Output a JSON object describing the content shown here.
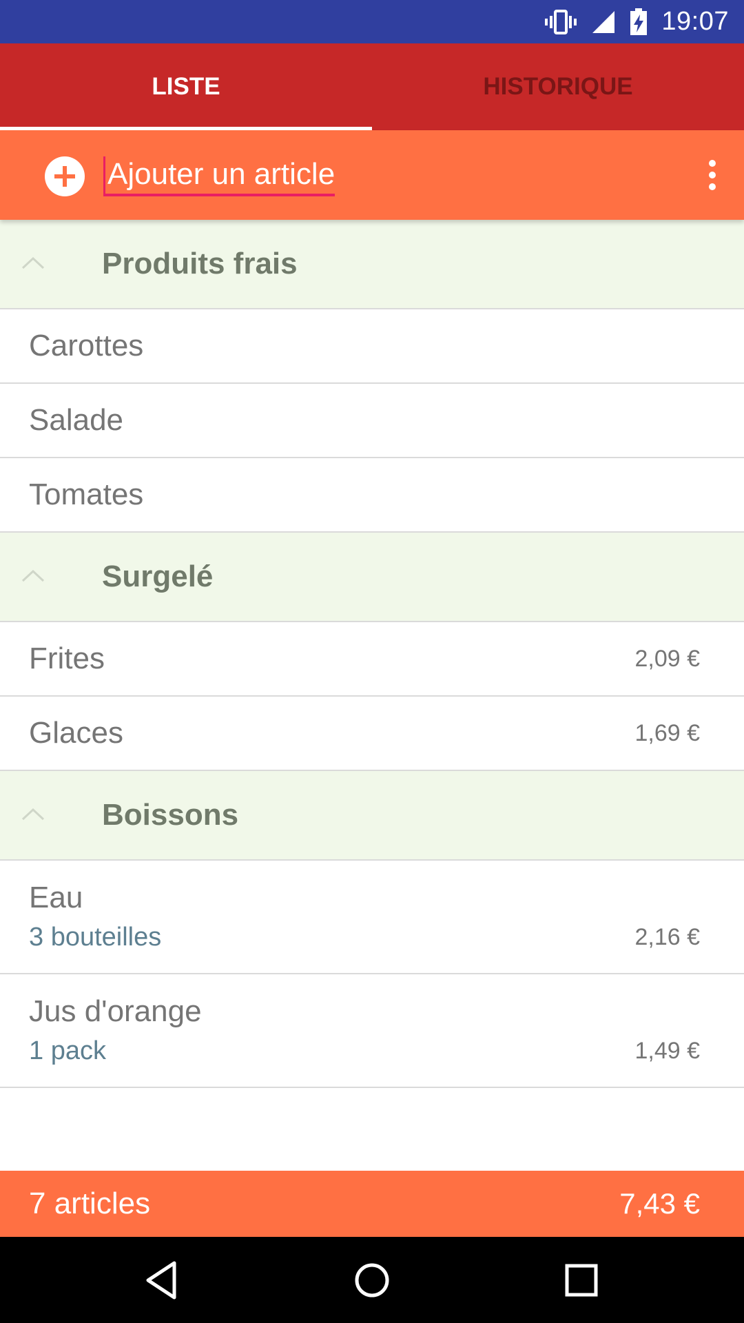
{
  "status_bar": {
    "time": "19:07",
    "icons": [
      "vibrate-icon",
      "signal-icon",
      "battery-charging-icon"
    ],
    "background": "#303F9F"
  },
  "tabs": [
    {
      "label": "LISTE",
      "active": true
    },
    {
      "label": "HISTORIQUE",
      "active": false
    }
  ],
  "add_bar": {
    "placeholder": "Ajouter un article",
    "icons": [
      "add-circle-icon",
      "more-vert-icon"
    ],
    "background": "#FF7043",
    "cursor_color": "#E91E63"
  },
  "categories": [
    {
      "title": "Produits frais",
      "items": [
        {
          "name": "Carottes"
        },
        {
          "name": "Salade"
        },
        {
          "name": "Tomates"
        }
      ]
    },
    {
      "title": "Surgelé",
      "items": [
        {
          "name": "Frites",
          "price": "2,09 €"
        },
        {
          "name": "Glaces",
          "price": "1,69 €"
        }
      ]
    },
    {
      "title": "Boissons",
      "items": [
        {
          "name": "Eau",
          "quantity": "3 bouteilles",
          "price": "2,16 €"
        },
        {
          "name": "Jus d'orange",
          "quantity": "1 pack",
          "price": "1,49 €"
        }
      ]
    }
  ],
  "footer": {
    "count": "7 articles",
    "total": "7,43 €"
  },
  "nav_bar": {
    "icons": [
      "back-icon",
      "home-icon",
      "recents-icon"
    ]
  },
  "colors": {
    "tab_bar": "#C62828",
    "category_background": "#F1F8E9",
    "quantity_text": "#5d7f90"
  }
}
